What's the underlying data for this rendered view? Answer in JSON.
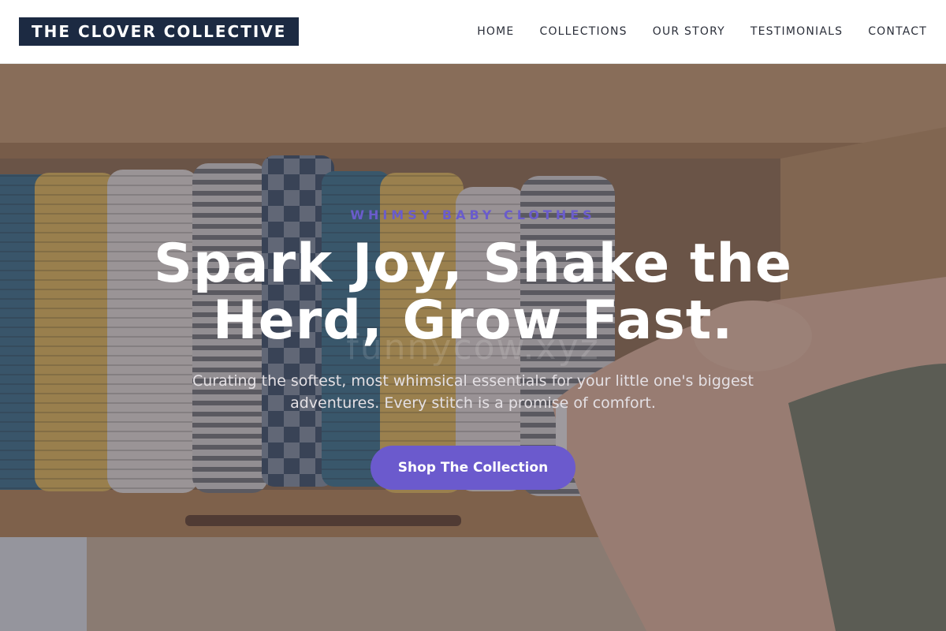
{
  "brand": {
    "name": "THE CLOVER COLLECTIVE"
  },
  "nav": {
    "items": [
      {
        "label": "HOME"
      },
      {
        "label": "COLLECTIONS"
      },
      {
        "label": "OUR STORY"
      },
      {
        "label": "TESTIMONIALS"
      },
      {
        "label": "CONTACT"
      }
    ]
  },
  "hero": {
    "eyebrow": "WHIMSY BABY CLOTHES",
    "headline_line1": "Spark Joy, Shake the",
    "headline_line2": "Herd, Grow Fast.",
    "subtext": "Curating the softest, most whimsical essentials for your little one's biggest adventures. Every stitch is a promise of comfort.",
    "cta_label": "Shop The Collection",
    "watermark": "funnycow.xyz"
  },
  "colors": {
    "logo_bg": "#1c2a42",
    "accent": "#6b5acd",
    "eyebrow": "#6a5ccc",
    "nav_text": "#2b2f3a"
  }
}
